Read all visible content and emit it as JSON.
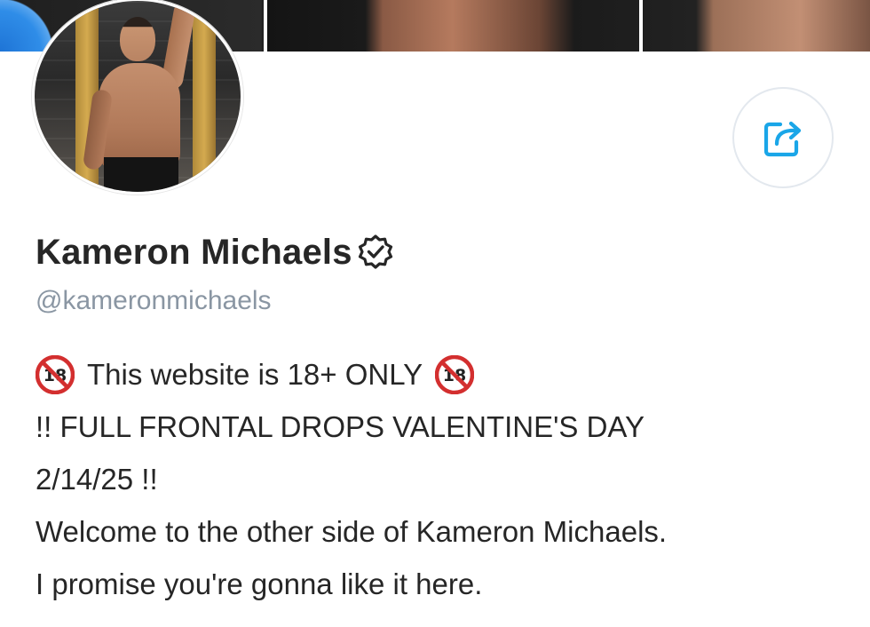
{
  "profile": {
    "name": "Kameron Michaels",
    "handle": "@kameronmichaels",
    "verified": true
  },
  "bio": {
    "line1": "This website is 18+ ONLY",
    "line2": "!! FULL FRONTAL DROPS VALENTINE'S DAY",
    "line3": "2/14/25 !!",
    "line4": "Welcome to the other side of Kameron Michaels.",
    "line5": "I promise you're gonna like it here."
  },
  "icons": {
    "share": "share-icon",
    "verified": "verified-badge-icon",
    "age_restriction": "no-one-under-eighteen-icon"
  },
  "colors": {
    "accent": "#1aa6e8",
    "text": "#262626",
    "muted": "#8a96a3",
    "border": "#e3e8ee",
    "badge_red": "#d32f2f"
  }
}
